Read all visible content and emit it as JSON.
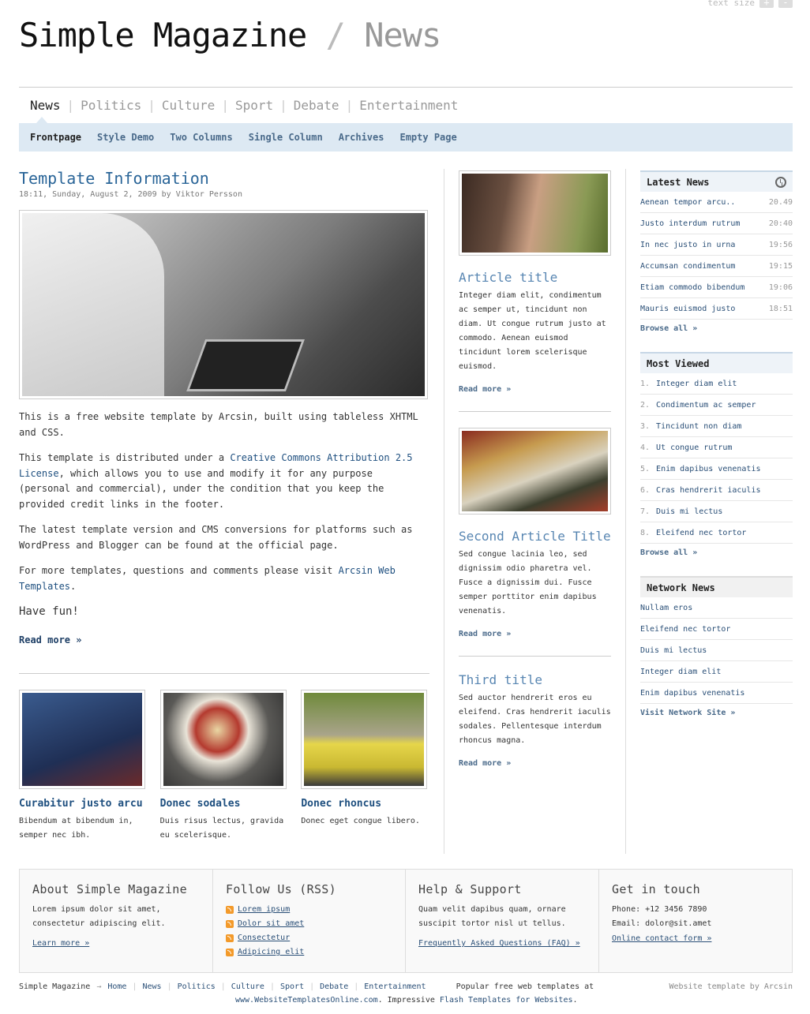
{
  "header": {
    "text_size_label": "text size",
    "text_size_increase": "+",
    "text_size_decrease": "-",
    "site_name": "Simple Magazine",
    "separator": "/",
    "section": "News"
  },
  "main_nav": [
    {
      "label": "News",
      "active": true
    },
    {
      "label": "Politics"
    },
    {
      "label": "Culture"
    },
    {
      "label": "Sport"
    },
    {
      "label": "Debate"
    },
    {
      "label": "Entertainment"
    }
  ],
  "sub_nav": [
    {
      "label": "Frontpage",
      "active": true
    },
    {
      "label": "Style Demo"
    },
    {
      "label": "Two Columns"
    },
    {
      "label": "Single Column"
    },
    {
      "label": "Archives"
    },
    {
      "label": "Empty Page"
    }
  ],
  "main_article": {
    "title": "Template Information",
    "meta": "18:11, Sunday, August 2, 2009 by Viktor Persson",
    "p1": "This is a free website template by Arcsin, built using tableless XHTML and CSS.",
    "p2_before": "This template is distributed under a ",
    "p2_link": "Creative Commons Attribution 2.5 License",
    "p2_after": ", which allows you to use and modify it for any purpose (personal and commercial), under the condition that you keep the provided credit links in the footer.",
    "p3": "The latest template version and CMS conversions for platforms such as WordPress and Blogger can be found at the official page.",
    "p4_before": "For more templates, questions and comments please visit ",
    "p4_link": "Arcsin Web Templates",
    "p4_after": ".",
    "p5": "Have fun!",
    "read_more": "Read more »"
  },
  "teasers": [
    {
      "title": "Curabitur justo arcu",
      "text": "Bibendum at bibendum in, semper nec ibh."
    },
    {
      "title": "Donec sodales",
      "text": "Duis risus lectus, gravida eu scelerisque."
    },
    {
      "title": "Donec rhoncus",
      "text": "Donec eget congue libero."
    }
  ],
  "mid_articles": [
    {
      "title": "Article title",
      "text": "Integer diam elit, condimentum ac semper ut, tincidunt non diam. Ut congue rutrum justo at commodo. Aenean euismod tincidunt lorem scelerisque euismod.",
      "read_more": "Read more »"
    },
    {
      "title": "Second Article Title",
      "text": "Sed congue lacinia leo, sed dignissim odio pharetra vel. Fusce a dignissim dui. Fusce semper porttitor enim dapibus venenatis.",
      "read_more": "Read more »"
    },
    {
      "title": "Third title",
      "text": "Sed auctor hendrerit eros eu eleifend. Cras hendrerit iaculis sodales. Pellentesque interdum rhoncus magna.",
      "read_more": "Read more »"
    }
  ],
  "latest_news": {
    "title": "Latest News",
    "items": [
      {
        "label": "Aenean tempor arcu..",
        "time": "20.49"
      },
      {
        "label": "Justo interdum rutrum",
        "time": "20:40"
      },
      {
        "label": "In nec justo in urna",
        "time": "19:56"
      },
      {
        "label": "Accumsan condimentum",
        "time": "19:15"
      },
      {
        "label": "Etiam commodo bibendum",
        "time": "19:06"
      },
      {
        "label": "Mauris euismod justo",
        "time": "18:51"
      }
    ],
    "browse": "Browse all »"
  },
  "most_viewed": {
    "title": "Most Viewed",
    "items": [
      {
        "num": "1.",
        "label": "Integer diam elit"
      },
      {
        "num": "2.",
        "label": "Condimentum ac semper"
      },
      {
        "num": "3.",
        "label": "Tincidunt non diam"
      },
      {
        "num": "4.",
        "label": "Ut congue rutrum"
      },
      {
        "num": "5.",
        "label": "Enim dapibus venenatis"
      },
      {
        "num": "6.",
        "label": "Cras hendrerit iaculis"
      },
      {
        "num": "7.",
        "label": "Duis mi lectus"
      },
      {
        "num": "8.",
        "label": "Eleifend nec tortor"
      }
    ],
    "browse": "Browse all »"
  },
  "network_news": {
    "title": "Network News",
    "items": [
      "Nullam eros",
      "Eleifend nec tortor",
      "Duis mi lectus",
      "Integer diam elit",
      "Enim dapibus venenatis"
    ],
    "visit": "Visit Network Site »"
  },
  "footer_boxes": {
    "about": {
      "title": "About Simple Magazine",
      "text": "Lorem ipsum dolor sit amet, consectetur adipiscing elit.",
      "link": "Learn more »"
    },
    "follow": {
      "title": "Follow Us (RSS)",
      "items": [
        "Lorem ipsum",
        "Dolor sit amet",
        "Consectetur",
        "Adipicing elit"
      ]
    },
    "help": {
      "title": "Help & Support",
      "text": "Quam velit dapibus quam, ornare suscipit tortor nisl ut tellus.",
      "link": "Frequently Asked Questions (FAQ) »"
    },
    "contact": {
      "title": "Get in touch",
      "phone": "Phone: +12 3456 7890",
      "email": "Email: dolor@sit.amet",
      "link": "Online contact form »"
    }
  },
  "bottom": {
    "site": "Simple Magazine",
    "arrow": "→",
    "nav": [
      "Home",
      "News",
      "Politics",
      "Culture",
      "Sport",
      "Debate",
      "Entertainment"
    ],
    "promo_prefix": "Popular free web templates at",
    "promo_link": "www.WebsiteTemplatesOnline.com",
    "promo_mid": ". Impressive",
    "promo_link2": "Flash Templates for Websites",
    "promo_end": ".",
    "credit": "Website template by Arcsin"
  }
}
